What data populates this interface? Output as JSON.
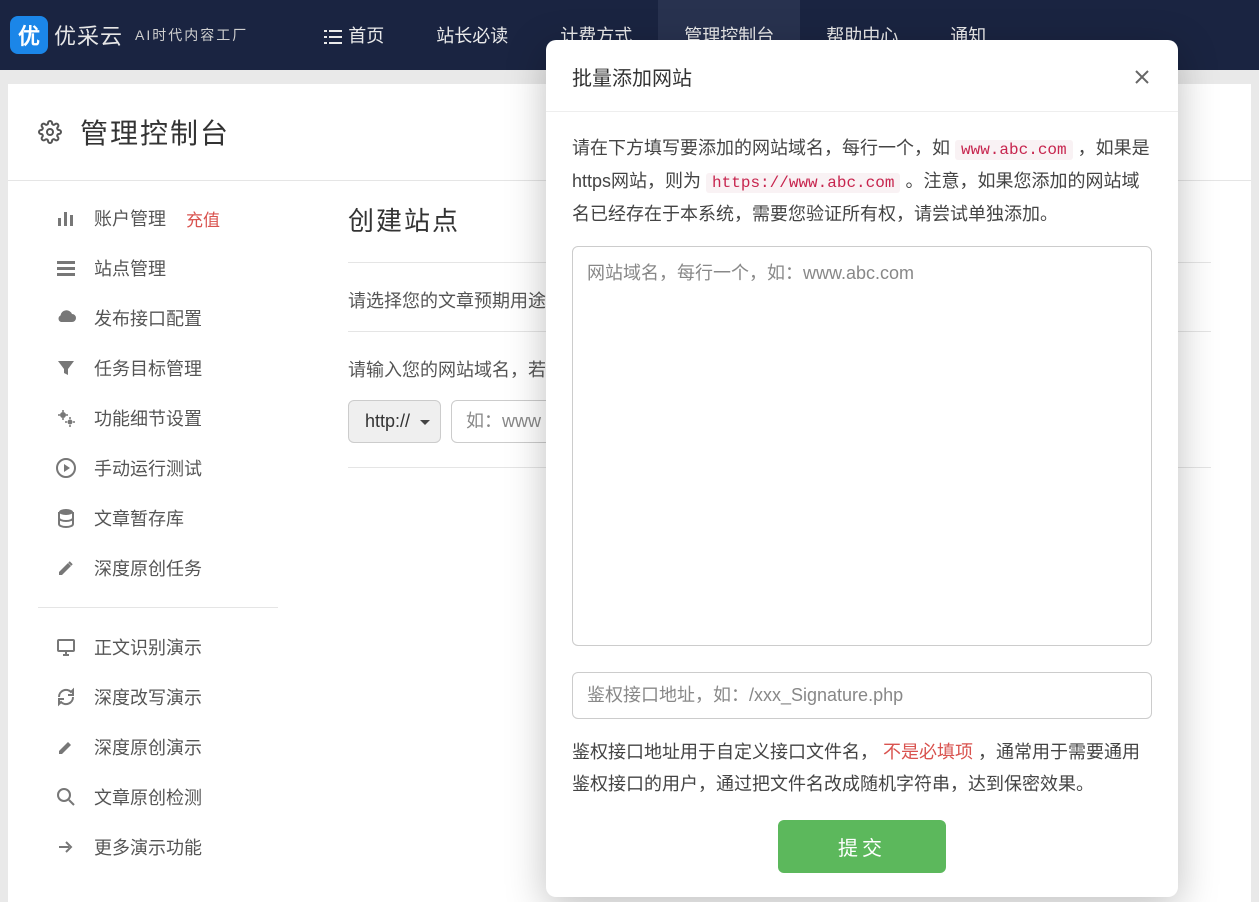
{
  "brand": {
    "name": "优采云",
    "tagline": "AI时代内容工厂"
  },
  "nav": {
    "items": [
      {
        "label": "首页",
        "has_icon": true
      },
      {
        "label": "站长必读"
      },
      {
        "label": "计费方式"
      },
      {
        "label": "管理控制台",
        "active": true
      },
      {
        "label": "帮助中心"
      },
      {
        "label": "通知"
      }
    ]
  },
  "panel": {
    "title": "管理控制台"
  },
  "sidebar": {
    "items": [
      {
        "label": "账户管理",
        "badge": "充值",
        "icon": "bar-chart"
      },
      {
        "label": "站点管理",
        "icon": "list"
      },
      {
        "label": "发布接口配置",
        "icon": "cloud"
      },
      {
        "label": "任务目标管理",
        "icon": "filter"
      },
      {
        "label": "功能细节设置",
        "icon": "cogs"
      },
      {
        "label": "手动运行测试",
        "icon": "play"
      },
      {
        "label": "文章暂存库",
        "icon": "database"
      },
      {
        "label": "深度原创任务",
        "icon": "edit"
      }
    ],
    "group2": [
      {
        "label": "正文识别演示",
        "icon": "desktop"
      },
      {
        "label": "深度改写演示",
        "icon": "refresh"
      },
      {
        "label": "深度原创演示",
        "icon": "edit"
      },
      {
        "label": "文章原创检测",
        "icon": "search"
      },
      {
        "label": "更多演示功能",
        "icon": "share"
      }
    ]
  },
  "main": {
    "title": "创建站点",
    "label_usage": "请选择您的文章预期用途",
    "label_domain": "请输入您的网站域名，若",
    "protocol_value": "http://",
    "domain_placeholder": "如：www"
  },
  "modal": {
    "title": "批量添加网站",
    "instruction_pre": "请在下方填写要添加的网站域名，每行一个，如 ",
    "example_http": "www.abc.com",
    "instruction_mid": " ，如果是https网站，则为 ",
    "example_https": "https://www.abc.com",
    "instruction_post": "。注意，如果您添加的网站域名已经存在于本系统，需要您验证所有权，请尝试单独添加。",
    "textarea_placeholder": "网站域名，每行一个，如：www.abc.com",
    "auth_placeholder": "鉴权接口地址，如：/xxx_Signature.php",
    "hint_pre": "鉴权接口地址用于自定义接口文件名，",
    "hint_red": "不是必填项",
    "hint_post": "，通常用于需要通用鉴权接口的用户，通过把文件名改成随机字符串，达到保密效果。",
    "submit": "提交"
  }
}
